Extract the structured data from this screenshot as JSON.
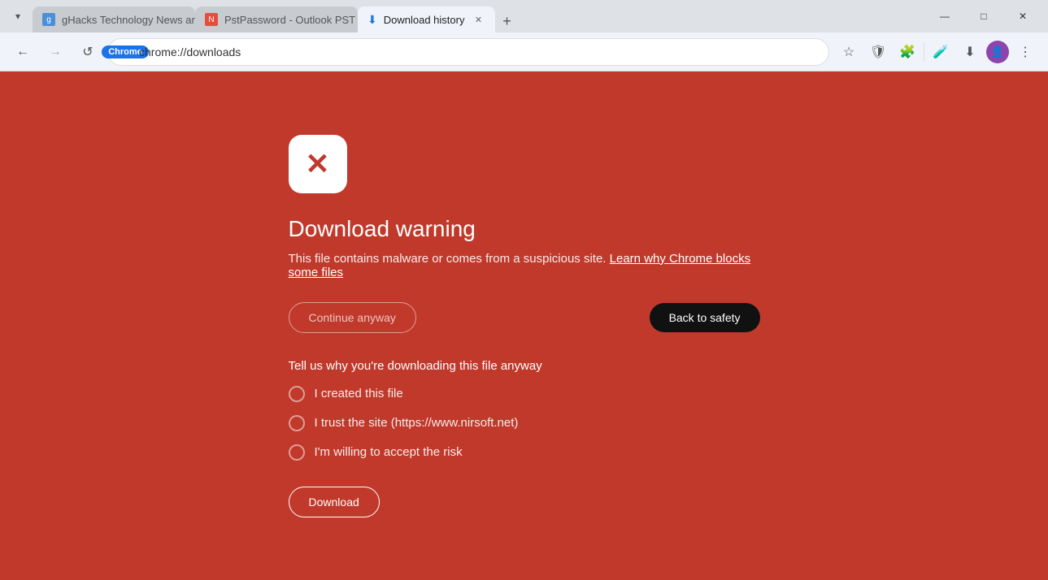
{
  "tabs": [
    {
      "id": "tab-ghacks",
      "label": "gHacks Technology News and ...",
      "favicon_type": "ghacks",
      "active": false
    },
    {
      "id": "tab-pst",
      "label": "PstPassword - Outlook PST Pas...",
      "favicon_type": "pst",
      "active": false
    },
    {
      "id": "tab-downloads",
      "label": "Download history",
      "favicon_type": "download",
      "active": true
    }
  ],
  "new_tab_label": "+",
  "window_controls": {
    "minimize": "—",
    "maximize": "□",
    "close": "✕"
  },
  "toolbar": {
    "back_label": "←",
    "forward_label": "→",
    "reload_label": "↺",
    "chrome_badge": "Chrome",
    "address": "chrome://downloads",
    "bookmark_icon": "☆",
    "shield_icon": "🛡",
    "extensions_icon": "🧩",
    "lab_icon": "🧪",
    "download_icon": "⬇",
    "menu_icon": "⋮"
  },
  "warning": {
    "title": "Download warning",
    "description": "This file contains malware or comes from a suspicious site.",
    "link_text": "Learn why Chrome blocks some files",
    "continue_label": "Continue anyway",
    "back_label": "Back to safety",
    "tell_us_label": "Tell us why you're downloading this file anyway",
    "radio_options": [
      {
        "id": "radio1",
        "label": "I created this file"
      },
      {
        "id": "radio2",
        "label": "I trust the site (https://www.nirsoft.net)"
      },
      {
        "id": "radio3",
        "label": "I'm willing to accept the risk"
      }
    ],
    "download_label": "Download"
  }
}
